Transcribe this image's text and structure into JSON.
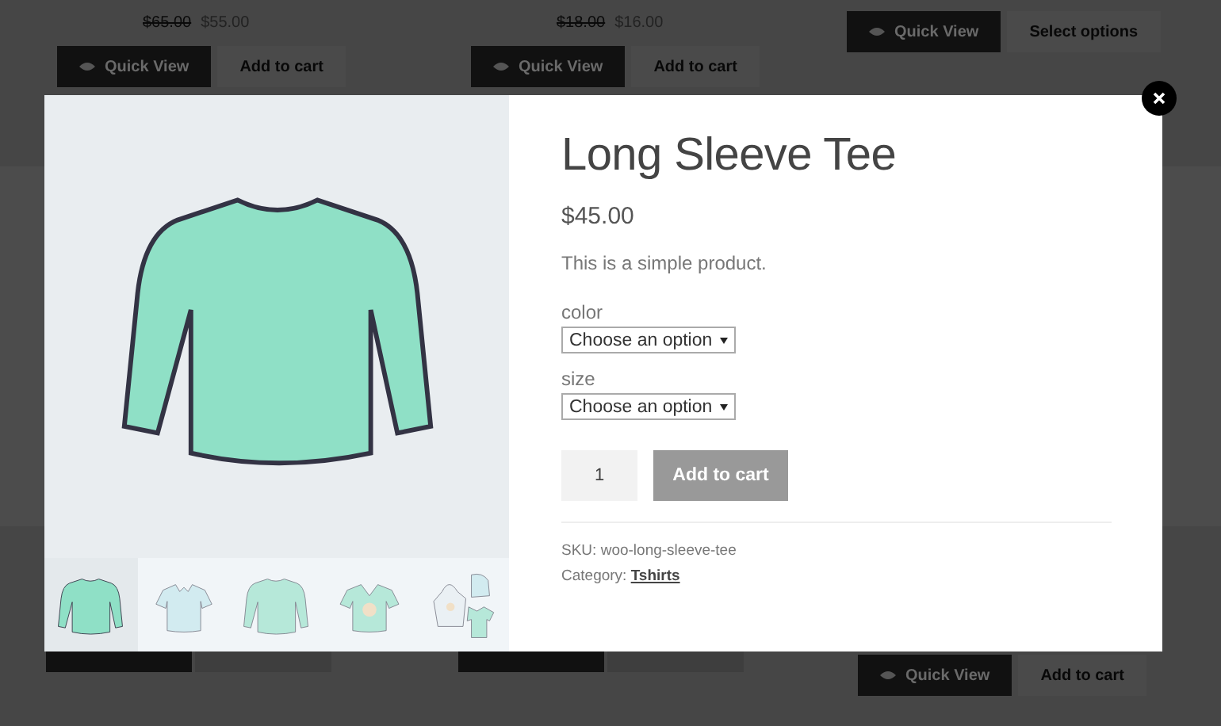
{
  "background": {
    "top_cards": [
      {
        "price_old": "$65.00",
        "price": "$55.00",
        "quick_view": "Quick View",
        "action": "Add to cart"
      },
      {
        "price_old": "$18.00",
        "price": "$16.00",
        "quick_view": "Quick View",
        "action": "Add to cart"
      },
      {
        "quick_view": "Quick View",
        "action": "Select options"
      }
    ],
    "bottom_card": {
      "quick_view": "Quick View",
      "action": "Add to cart"
    }
  },
  "modal": {
    "title": "Long Sleeve Tee",
    "price": "$45.00",
    "description": "This is a simple product.",
    "attributes": [
      {
        "label": "color",
        "value": "Choose an option"
      },
      {
        "label": "size",
        "value": "Choose an option"
      }
    ],
    "quantity": "1",
    "add_to_cart": "Add to cart",
    "sku_label": "SKU:",
    "sku": "woo-long-sleeve-tee",
    "category_label": "Category:",
    "category": "Tshirts",
    "thumbnails": [
      {
        "kind": "longsleeve",
        "selected": true
      },
      {
        "kind": "polo",
        "selected": false
      },
      {
        "kind": "longsleeve",
        "selected": false
      },
      {
        "kind": "vneck",
        "selected": false
      },
      {
        "kind": "set",
        "selected": false
      }
    ]
  }
}
